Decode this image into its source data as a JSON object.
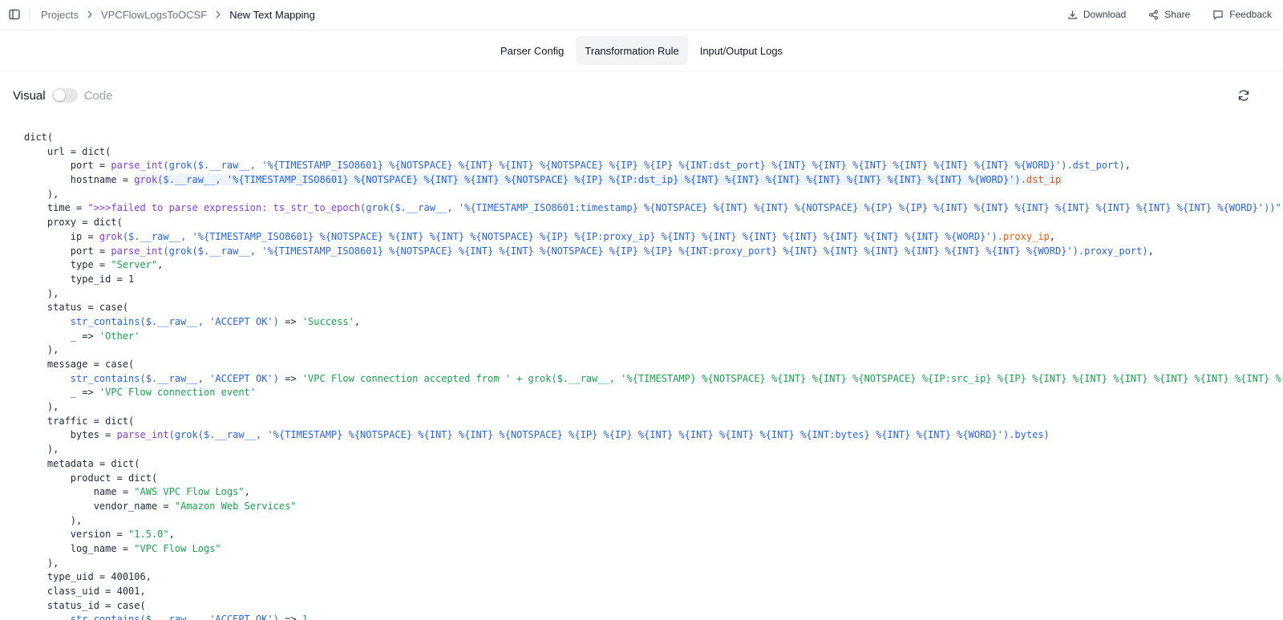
{
  "breadcrumb": {
    "items": [
      "Projects",
      "VPCFlowLogsToOCSF",
      "New Text Mapping"
    ]
  },
  "actions": {
    "download": "Download",
    "share": "Share",
    "feedback": "Feedback"
  },
  "tabs": [
    {
      "label": "Parser Config",
      "active": false
    },
    {
      "label": "Transformation Rule",
      "active": true
    },
    {
      "label": "Input/Output Logs",
      "active": false
    }
  ],
  "editor": {
    "visual_label": "Visual",
    "code_label": "Code",
    "mode": "visual"
  },
  "colors": {
    "function": "#7c3aed",
    "grok_call": "#2563eb",
    "string": "#16a34a",
    "field": "#ea580c",
    "highlight": "#eef4fc"
  },
  "code": [
    {
      "indent": 0,
      "t": [
        [
          "p",
          "dict("
        ]
      ]
    },
    {
      "indent": 1,
      "t": [
        [
          "p",
          "url = dict("
        ]
      ]
    },
    {
      "indent": 2,
      "t": [
        [
          "p",
          "port = "
        ],
        [
          "f",
          "parse_int"
        ],
        [
          "b",
          "(grok($.__raw__, '%{TIMESTAMP_ISO8601} %{NOTSPACE} %{INT} %{INT} %{NOTSPACE} %{IP} %{IP} %{INT:dst_port} %{INT} %{INT} %{INT} %{INT} %{INT} %{INT} %{WORD}').dst_port)"
        ],
        [
          "p",
          ","
        ]
      ]
    },
    {
      "indent": 2,
      "hl": true,
      "t": [
        [
          "p",
          "hostname = "
        ],
        [
          "f",
          "grok"
        ],
        [
          "b",
          "($.__raw__, '%{TIMESTAMP_ISO8601} %{NOTSPACE} %{INT} %{INT} %{NOTSPACE} %{IP} %{IP:dst_ip} %{INT} %{INT} %{INT} %{INT} %{INT} %{INT} %{INT} %{WORD}')"
        ],
        [
          "o",
          ".dst_ip"
        ]
      ]
    },
    {
      "indent": 1,
      "t": [
        [
          "p",
          "),"
        ]
      ]
    },
    {
      "indent": 1,
      "t": [
        [
          "p",
          "time = "
        ],
        [
          "f",
          "\">>>failed to parse expression: ts_str_to_epoch"
        ],
        [
          "b",
          "(grok($.__raw__, '%{TIMESTAMP_ISO8601:timestamp} %{NOTSPACE} %{INT} %{INT} %{NOTSPACE} %{IP} %{IP} %{INT} %{INT} %{INT} %{INT} %{INT} %{INT} %{INT} %{WORD}'))\""
        ]
      ]
    },
    {
      "indent": 1,
      "t": [
        [
          "p",
          "proxy = dict("
        ]
      ]
    },
    {
      "indent": 2,
      "t": [
        [
          "p",
          "ip = "
        ],
        [
          "f",
          "grok"
        ],
        [
          "b",
          "($.__raw__, '%{TIMESTAMP_ISO8601} %{NOTSPACE} %{INT} %{INT} %{NOTSPACE} %{IP} %{IP:proxy_ip} %{INT} %{INT} %{INT} %{INT} %{INT} %{INT} %{INT} %{WORD}')"
        ],
        [
          "o",
          ".proxy_ip"
        ],
        [
          "p",
          ","
        ]
      ]
    },
    {
      "indent": 2,
      "t": [
        [
          "p",
          "port = "
        ],
        [
          "f",
          "parse_int"
        ],
        [
          "b",
          "(grok($.__raw__, '%{TIMESTAMP_ISO8601} %{NOTSPACE} %{INT} %{INT} %{NOTSPACE} %{IP} %{IP} %{INT:proxy_port} %{INT} %{INT} %{INT} %{INT} %{INT} %{INT} %{WORD}').proxy_port)"
        ],
        [
          "p",
          ","
        ]
      ]
    },
    {
      "indent": 2,
      "t": [
        [
          "p",
          "type = "
        ],
        [
          "s",
          "\"Server\""
        ],
        [
          "p",
          ","
        ]
      ]
    },
    {
      "indent": 2,
      "t": [
        [
          "p",
          "type_id = 1"
        ]
      ]
    },
    {
      "indent": 1,
      "t": [
        [
          "p",
          "),"
        ]
      ]
    },
    {
      "indent": 1,
      "t": [
        [
          "p",
          "status = case("
        ]
      ]
    },
    {
      "indent": 2,
      "t": [
        [
          "b",
          "str_contains($.__raw__, 'ACCEPT OK')"
        ],
        [
          "p",
          " => "
        ],
        [
          "s",
          "'Success'"
        ],
        [
          "p",
          ","
        ]
      ]
    },
    {
      "indent": 2,
      "t": [
        [
          "p",
          "_ => "
        ],
        [
          "s",
          "'Other'"
        ]
      ]
    },
    {
      "indent": 1,
      "t": [
        [
          "p",
          "),"
        ]
      ]
    },
    {
      "indent": 1,
      "t": [
        [
          "p",
          "message = case("
        ]
      ]
    },
    {
      "indent": 2,
      "t": [
        [
          "b",
          "str_contains($.__raw__, 'ACCEPT OK')"
        ],
        [
          "p",
          " => "
        ],
        [
          "s",
          "'VPC Flow connection accepted from ' + grok($.__raw__, '%{TIMESTAMP} %{NOTSPACE} %{INT} %{INT} %{NOTSPACE} %{IP:src_ip} %{IP} %{INT} %{INT} %{INT} %{INT} %{INT} %{INT} %{INT} %{WORD}').src_ip,"
        ]
      ]
    },
    {
      "indent": 2,
      "t": [
        [
          "p",
          "_ => "
        ],
        [
          "s",
          "'VPC Flow connection event'"
        ]
      ]
    },
    {
      "indent": 1,
      "t": [
        [
          "p",
          "),"
        ]
      ]
    },
    {
      "indent": 1,
      "t": [
        [
          "p",
          "traffic = dict("
        ]
      ]
    },
    {
      "indent": 2,
      "t": [
        [
          "p",
          "bytes = "
        ],
        [
          "f",
          "parse_int"
        ],
        [
          "b",
          "(grok($.__raw__, '%{TIMESTAMP} %{NOTSPACE} %{INT} %{INT} %{NOTSPACE} %{IP} %{IP} %{INT} %{INT} %{INT} %{INT} %{INT:bytes} %{INT} %{INT} %{WORD}').bytes)"
        ]
      ]
    },
    {
      "indent": 1,
      "t": [
        [
          "p",
          "),"
        ]
      ]
    },
    {
      "indent": 1,
      "t": [
        [
          "p",
          "metadata = dict("
        ]
      ]
    },
    {
      "indent": 2,
      "t": [
        [
          "p",
          "product = dict("
        ]
      ]
    },
    {
      "indent": 3,
      "t": [
        [
          "p",
          "name = "
        ],
        [
          "s",
          "\"AWS VPC Flow Logs\""
        ],
        [
          "p",
          ","
        ]
      ]
    },
    {
      "indent": 3,
      "t": [
        [
          "p",
          "vendor_name = "
        ],
        [
          "s",
          "\"Amazon Web Services\""
        ]
      ]
    },
    {
      "indent": 2,
      "t": [
        [
          "p",
          "),"
        ]
      ]
    },
    {
      "indent": 2,
      "t": [
        [
          "p",
          "version = "
        ],
        [
          "s",
          "\"1.5.0\""
        ],
        [
          "p",
          ","
        ]
      ]
    },
    {
      "indent": 2,
      "t": [
        [
          "p",
          "log_name = "
        ],
        [
          "s",
          "\"VPC Flow Logs\""
        ]
      ]
    },
    {
      "indent": 1,
      "t": [
        [
          "p",
          "),"
        ]
      ]
    },
    {
      "indent": 1,
      "t": [
        [
          "p",
          "type_uid = 400106,"
        ]
      ]
    },
    {
      "indent": 1,
      "t": [
        [
          "p",
          "class_uid = 4001,"
        ]
      ]
    },
    {
      "indent": 1,
      "t": [
        [
          "p",
          "status_id = case("
        ]
      ]
    },
    {
      "indent": 2,
      "t": [
        [
          "b",
          "str_contains($.__raw__, 'ACCEPT OK')"
        ],
        [
          "p",
          " => "
        ],
        [
          "n",
          "1"
        ],
        [
          "p",
          ","
        ]
      ]
    }
  ]
}
